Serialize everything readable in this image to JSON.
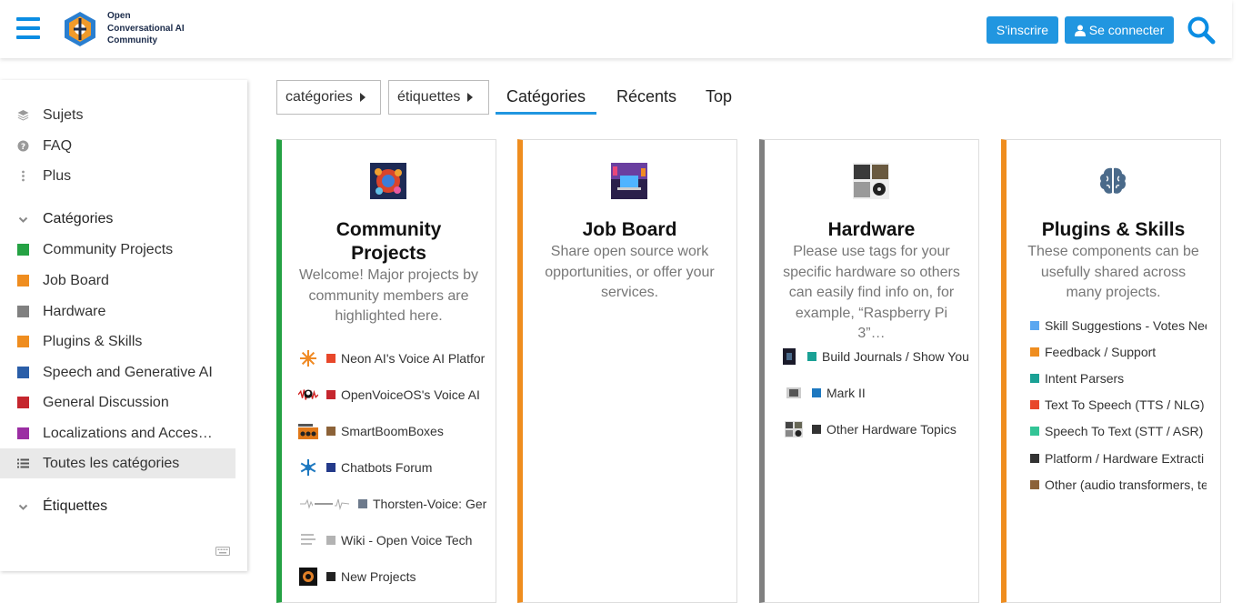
{
  "header": {
    "logo_text": [
      "Open",
      "Conversational AI",
      "Community"
    ],
    "signup_label": "S'inscrire",
    "login_label": "Se connecter"
  },
  "sidebar": {
    "top_items": [
      {
        "label": "Sujets",
        "icon": "layers-icon"
      },
      {
        "label": "FAQ",
        "icon": "question-icon"
      },
      {
        "label": "Plus",
        "icon": "vertical-ellipsis-icon"
      }
    ],
    "categories_heading": "Catégories",
    "categories": [
      {
        "label": "Community Projects",
        "color": "#25a244"
      },
      {
        "label": "Job Board",
        "color": "#ef8d1f"
      },
      {
        "label": "Hardware",
        "color": "#808080"
      },
      {
        "label": "Plugins & Skills",
        "color": "#ef8d1f"
      },
      {
        "label": "Speech and Generative AI",
        "color": "#2a5ea8"
      },
      {
        "label": "General Discussion",
        "color": "#c5262e"
      },
      {
        "label": "Localizations and Acces…",
        "color": "#9b2ea3"
      }
    ],
    "all_categories": "Toutes les catégories",
    "tags_heading": "Étiquettes"
  },
  "nav": {
    "dropdown_categories": "catégories",
    "dropdown_tags": "étiquettes",
    "tabs": [
      "Catégories",
      "Récents",
      "Top"
    ]
  },
  "cards": [
    {
      "title": "Community Projects",
      "color": "#25a244",
      "desc": "Welcome! Major projects by community members are highlighted here.",
      "subs": [
        {
          "label": "Neon AI's Voice AI Platfor",
          "color": "#e8472a"
        },
        {
          "label": "OpenVoiceOS's Voice AI",
          "color": "#c5262e"
        },
        {
          "label": "SmartBoomBoxes",
          "color": "#8c6238"
        },
        {
          "label": "Chatbots Forum",
          "color": "#243a8a"
        },
        {
          "label": "Thorsten-Voice: Ger",
          "color": "#6d7a8c"
        },
        {
          "label": "Wiki - Open Voice Tech",
          "color": "#b3b3b3"
        },
        {
          "label": "New Projects",
          "color": "#222222"
        }
      ]
    },
    {
      "title": "Job Board",
      "color": "#ef8d1f",
      "desc": "Share open source work opportunities, or offer your services.",
      "subs": []
    },
    {
      "title": "Hardware",
      "color": "#808080",
      "desc": "Please use tags for your specific hardware so others can easily find info on, for example, “Raspberry Pi 3”…",
      "subs": [
        {
          "label": "Build Journals / Show You",
          "color": "#1aa195"
        },
        {
          "label": "Mark II",
          "color": "#1d78c0"
        },
        {
          "label": "Other Hardware Topics",
          "color": "#333333"
        }
      ]
    },
    {
      "title": "Plugins & Skills",
      "color": "#ef8d1f",
      "desc": "These components can be usefully shared across many projects.",
      "subs": [
        {
          "label": "Skill Suggestions - Votes Nee",
          "color": "#5aa7f0"
        },
        {
          "label": "Feedback / Support",
          "color": "#ef8d1f"
        },
        {
          "label": "Intent Parsers",
          "color": "#1aa195"
        },
        {
          "label": "Text To Speech (TTS / NLG)",
          "color": "#e8472a"
        },
        {
          "label": "Speech To Text (STT / ASR)",
          "color": "#33c496"
        },
        {
          "label": "Platform / Hardware Extracti",
          "color": "#333333"
        },
        {
          "label": "Other (audio transformers, te",
          "color": "#8c6238"
        }
      ]
    }
  ]
}
